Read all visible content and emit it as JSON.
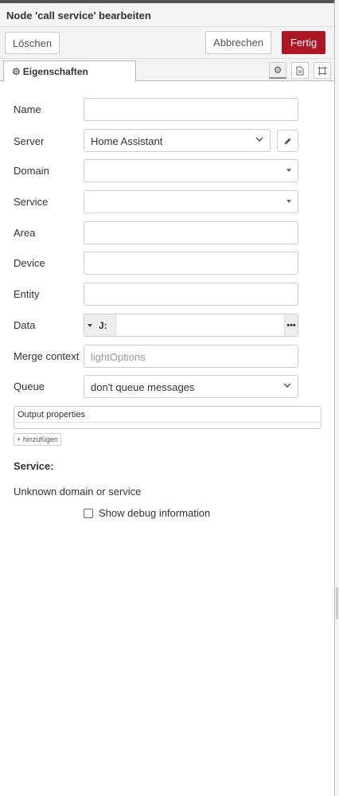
{
  "dialog": {
    "title": "Node 'call service' bearbeiten"
  },
  "actions": {
    "delete_label": "Löschen",
    "cancel_label": "Abbrechen",
    "done_label": "Fertig"
  },
  "tabs": [
    {
      "label": "Eigenschaften",
      "icon": "gear-icon",
      "active": true
    }
  ],
  "tab_icons": [
    "gear-icon",
    "description-icon",
    "appearance-icon"
  ],
  "form": {
    "name": {
      "label": "Name",
      "value": ""
    },
    "server": {
      "label": "Server",
      "value": "Home Assistant"
    },
    "domain": {
      "label": "Domain",
      "value": ""
    },
    "service": {
      "label": "Service",
      "value": ""
    },
    "area": {
      "label": "Area",
      "value": ""
    },
    "device": {
      "label": "Device",
      "value": ""
    },
    "entity": {
      "label": "Entity",
      "value": ""
    },
    "data": {
      "label": "Data",
      "type_label": "J:",
      "value": "",
      "expand_label": "•••"
    },
    "merge_context": {
      "label": "Merge context",
      "placeholder": "lightOptions"
    },
    "queue": {
      "label": "Queue",
      "value": "don't queue messages"
    }
  },
  "output": {
    "header": "Output properties",
    "add_label": "+ hinzufügen"
  },
  "service_info": {
    "heading": "Service:",
    "message": "Unknown domain or service"
  },
  "debug": {
    "label": "Show debug information",
    "checked": false
  },
  "colors": {
    "primary": "#ad1625",
    "border": "#cccccc",
    "panel": "#f3f3f3"
  }
}
